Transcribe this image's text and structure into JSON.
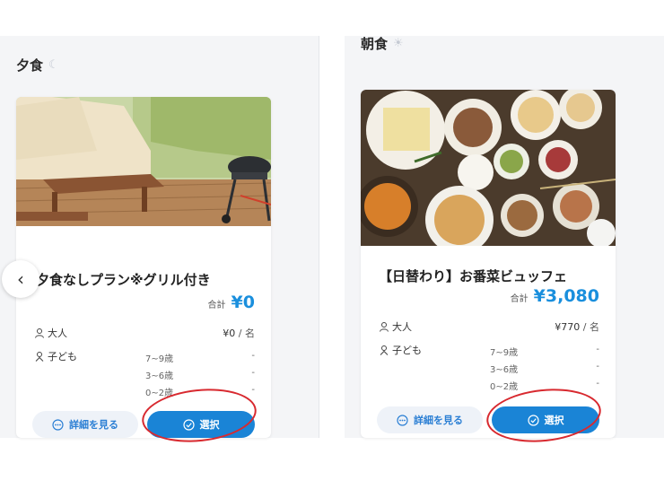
{
  "dinner": {
    "section_title": "夕食",
    "section_icon": "moon-icon",
    "plan": {
      "title": "夕食なしプラン※グリル付き",
      "total_label": "合計",
      "total_price": "¥0",
      "adult_label": "大人",
      "adult_price": "¥0",
      "per_unit": "/ 名",
      "child_label": "子ども",
      "ages": [
        {
          "range": "7~9歳",
          "price": "-"
        },
        {
          "range": "3~6歳",
          "price": "-"
        },
        {
          "range": "0~2歳",
          "price": "-"
        }
      ],
      "detail_button": "詳細を見る",
      "select_button": "選択"
    }
  },
  "breakfast": {
    "section_title": "朝食",
    "section_icon": "sun-icon",
    "plan": {
      "title": "【日替わり】お番菜ビュッフェ",
      "total_label": "合計",
      "total_price": "¥3,080",
      "adult_label": "大人",
      "adult_price": "¥770",
      "per_unit": "/ 名",
      "child_label": "子ども",
      "ages": [
        {
          "range": "7~9歳",
          "price": "-"
        },
        {
          "range": "3~6歳",
          "price": "-"
        },
        {
          "range": "0~2歳",
          "price": "-"
        }
      ],
      "detail_button": "詳細を見る",
      "select_button": "選択"
    }
  },
  "carousel": {
    "prev_icon": "chevron-left-icon"
  },
  "colors": {
    "accent": "#1a84d6",
    "price": "#1a8fdd",
    "annotation": "#d8292f"
  }
}
